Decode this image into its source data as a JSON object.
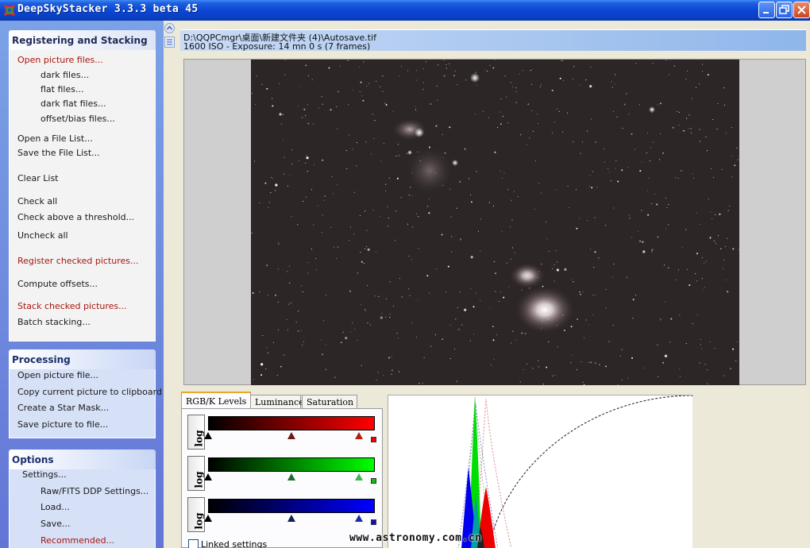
{
  "window": {
    "title": "DeepSkyStacker 3.3.3 beta 45"
  },
  "tasks": {
    "registering": {
      "header": "Registering and Stacking",
      "items": {
        "open_picture_files": "Open picture files...",
        "dark_files": "dark files...",
        "flat_files": "flat files...",
        "dark_flat_files": "dark flat files...",
        "offset_bias_files": "offset/bias files...",
        "open_file_list": "Open a File List...",
        "save_file_list": "Save the File List...",
        "clear_list": "Clear List",
        "check_all": "Check all",
        "check_above_threshold": "Check above a threshold...",
        "uncheck_all": "Uncheck all",
        "register_checked": "Register checked pictures...",
        "compute_offsets": "Compute offsets...",
        "stack_checked": "Stack checked pictures...",
        "batch_stacking": "Batch stacking..."
      }
    },
    "processing": {
      "header": "Processing",
      "items": {
        "open_picture_file": "Open picture file...",
        "copy_to_clipboard": "Copy current picture to clipboard",
        "create_star_mask": "Create a Star Mask...",
        "save_picture": "Save picture to file..."
      }
    },
    "options": {
      "header": "Options",
      "items": {
        "settings": "Settings...",
        "raw_fits": "Raw/FITS DDP Settings...",
        "load": "Load...",
        "save": "Save...",
        "recommended": "Recommended..."
      }
    }
  },
  "info": {
    "file_path": "D:\\QQPCmgr\\桌面\\新建文件夹 (4)\\Autosave.tif",
    "exposure": "1600 ISO - Exposure: 14 mn 0 s (7 frames)"
  },
  "tabs": [
    "RGB/K Levels",
    "Luminance",
    "Saturation"
  ],
  "levels": {
    "channels": [
      {
        "name": "red",
        "color": "#ff0000",
        "black": 0.0,
        "mid": 0.5,
        "white": 0.905
      },
      {
        "name": "green",
        "color": "#00ff00",
        "black": 0.0,
        "mid": 0.5,
        "white": 0.905
      },
      {
        "name": "blue",
        "color": "#0000ff",
        "black": 0.0,
        "mid": 0.5,
        "white": 0.905
      }
    ],
    "log_label": "log",
    "linked_settings_label": "Linked settings",
    "linked_checked": false
  },
  "watermark": "www.astronomy.com.cn"
}
